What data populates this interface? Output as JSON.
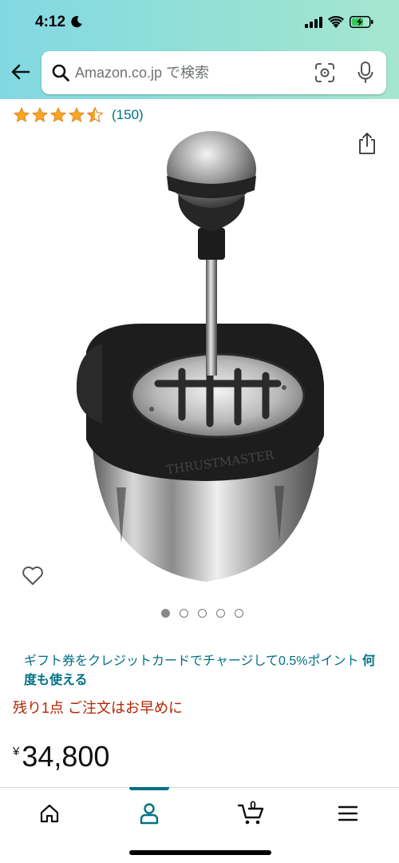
{
  "status_bar": {
    "time": "4:12"
  },
  "search": {
    "placeholder": "Amazon.co.jp で検索"
  },
  "rating": {
    "stars": 4.5,
    "count_text": "(150)"
  },
  "carousel": {
    "total_images": 5,
    "active_index": 0
  },
  "promo": {
    "text": "ギフト券をクレジットカードでチャージして0.5%ポイント",
    "link_text": "何度も使える"
  },
  "stock_text": "残り1点 ご注文はお早めに",
  "price": {
    "currency_symbol": "¥",
    "amount": "34,800"
  },
  "bottom_nav": {
    "cart_count": "0"
  },
  "colors": {
    "header_gradient_start": "#82d8e3",
    "header_gradient_end": "#a6e6cf",
    "link": "#007185",
    "stock_warning": "#b12704",
    "star": "#f5a623"
  }
}
